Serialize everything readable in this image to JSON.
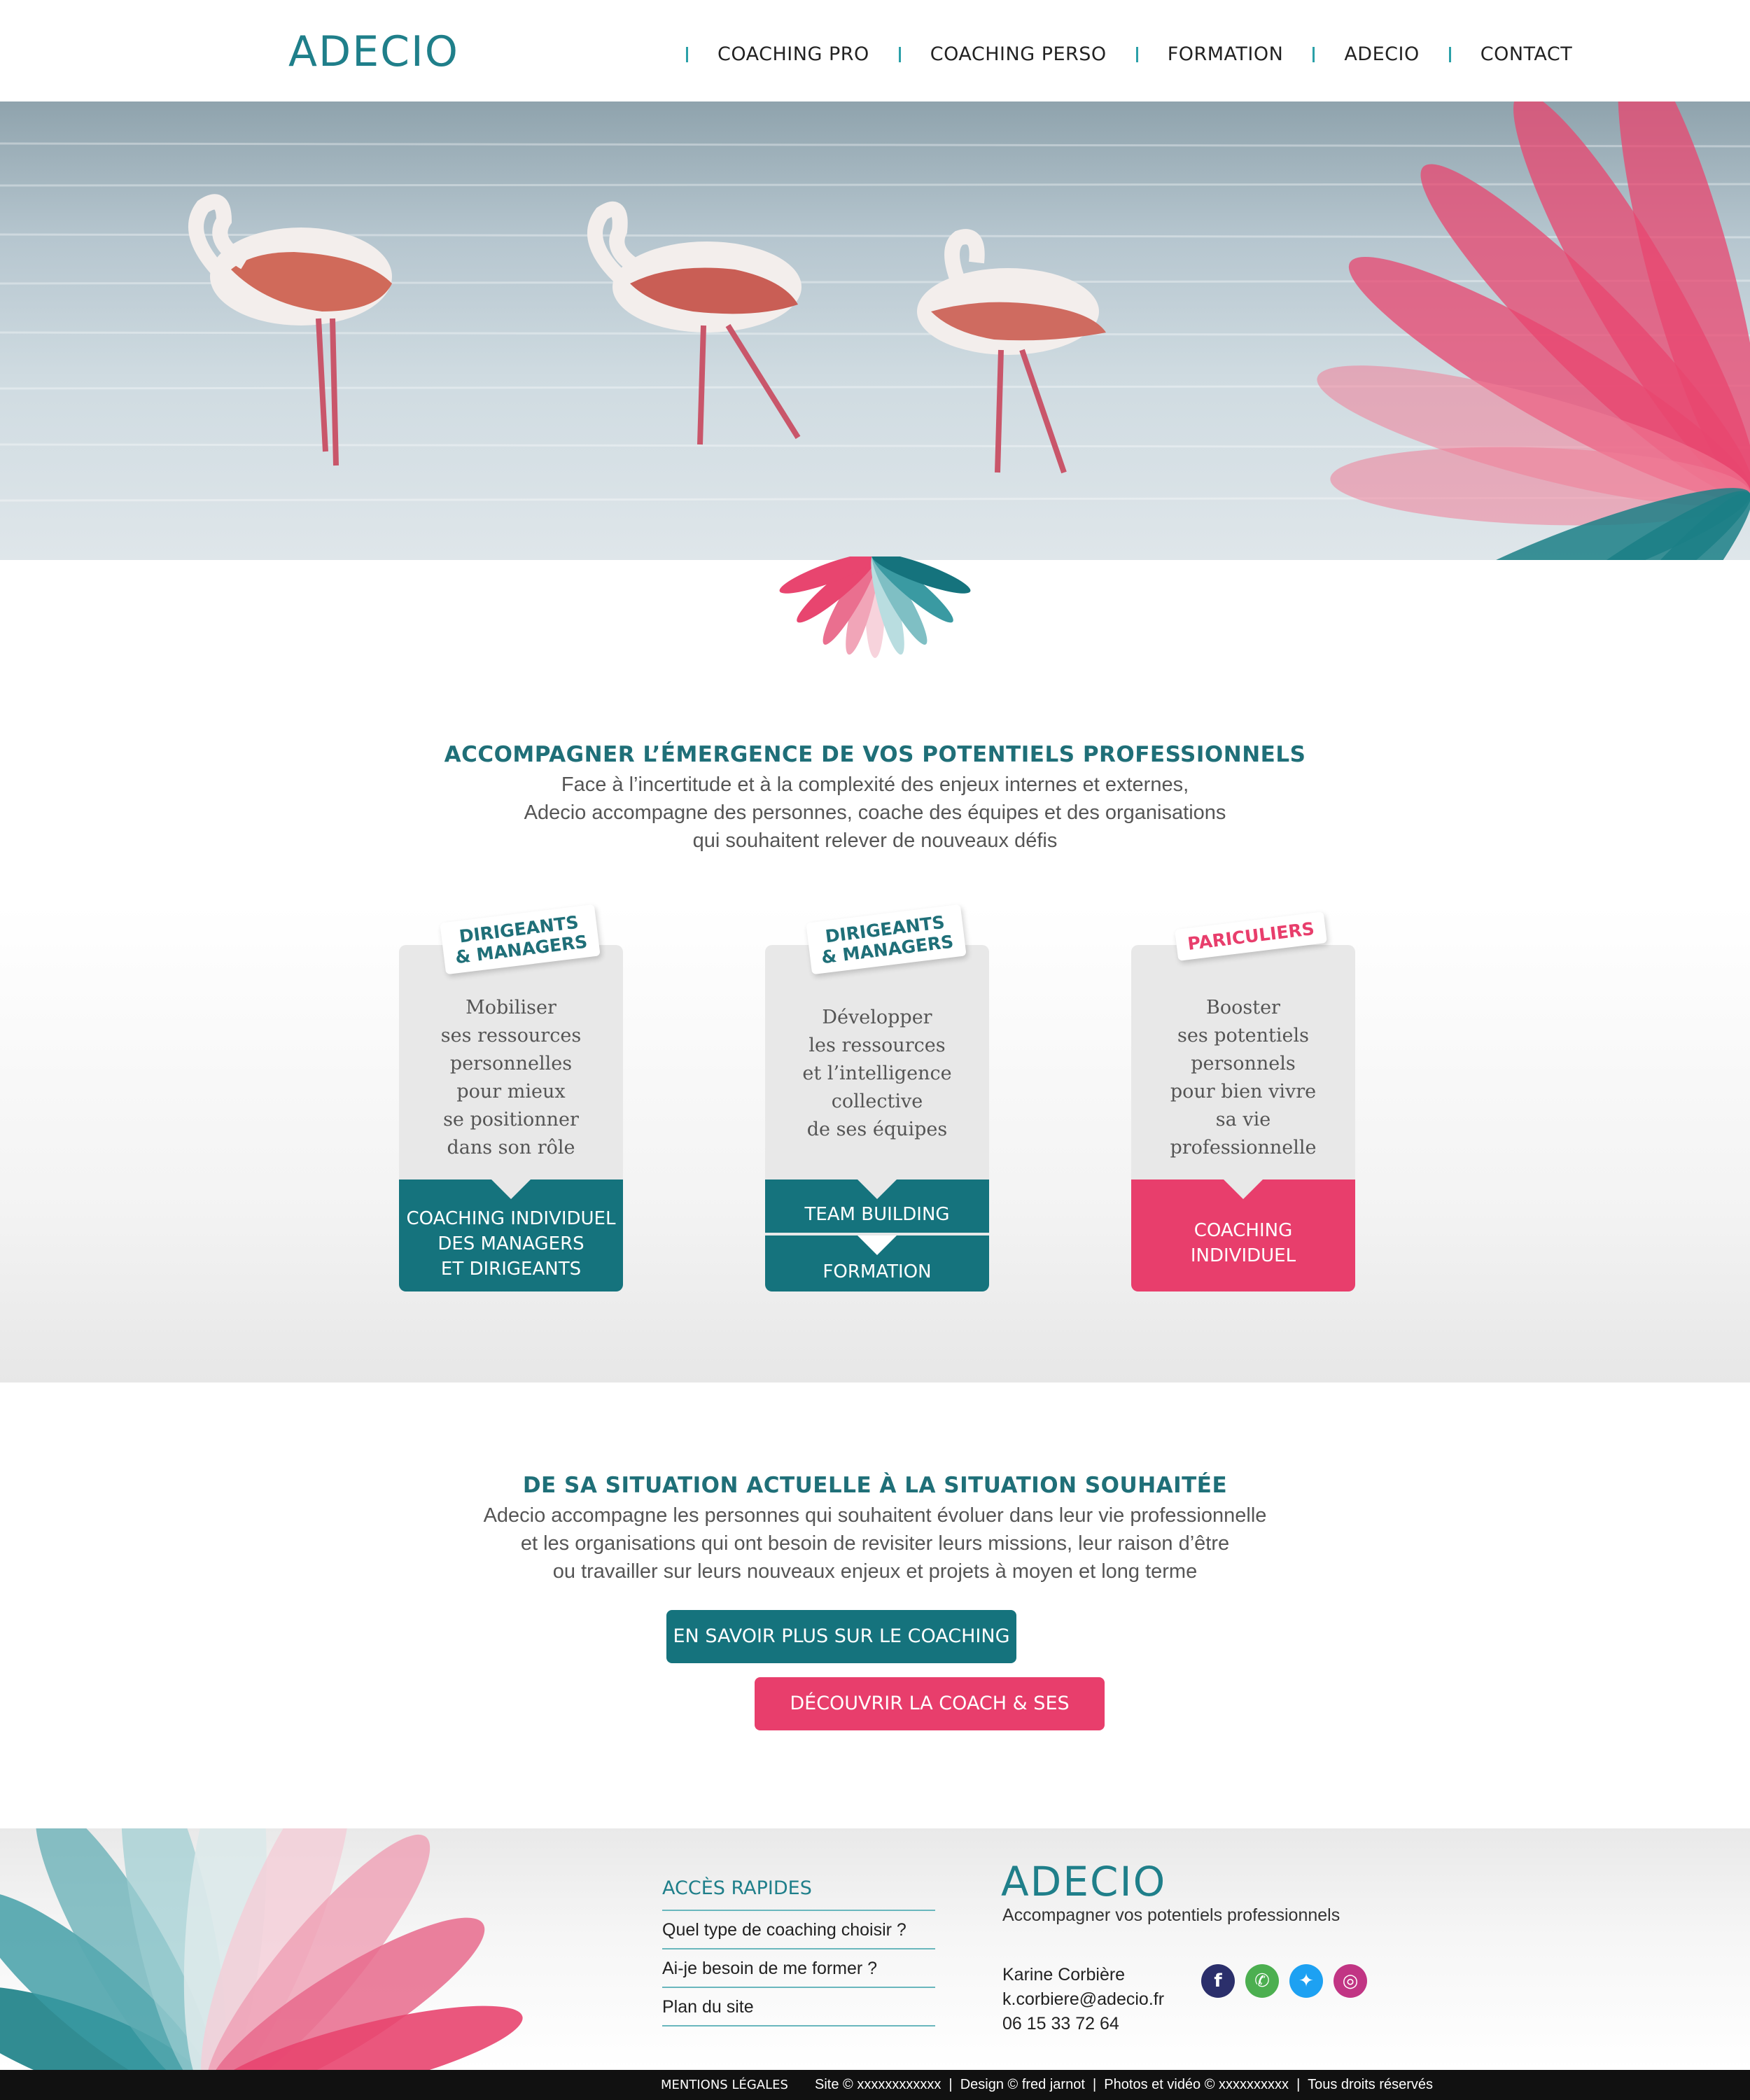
{
  "header": {
    "logo": "ADECIO",
    "nav": [
      "COACHING PRO",
      "COACHING PERSO",
      "FORMATION",
      "ADECIO",
      "CONTACT"
    ]
  },
  "intro": {
    "title": "ACCOMPAGNER L’ÉMERGENCE DE VOS POTENTIELS PROFESSIONNELS",
    "lines": [
      "Face à l’incertitude et à la complexité des enjeux internes et externes,",
      "Adecio accompagne des personnes, coache des équipes et des organisations",
      "qui souhaitent relever de nouveaux défis"
    ]
  },
  "cards": [
    {
      "tag_lines": [
        "DIRIGEANTS",
        "& MANAGERS"
      ],
      "body_lines": [
        "Mobiliser",
        "ses ressources",
        "personnelles",
        "pour mieux",
        "se positionner",
        "dans son rôle"
      ],
      "footer_lines": [
        "COACHING INDIVIDUEL",
        "DES MANAGERS",
        "ET DIRIGEANTS"
      ]
    },
    {
      "tag_lines": [
        "DIRIGEANTS",
        "& MANAGERS"
      ],
      "body_lines": [
        "Développer",
        "les ressources",
        "et l’intelligence",
        "collective",
        "de ses équipes"
      ],
      "footer_buttons": [
        "TEAM BUILDING",
        "FORMATION"
      ]
    },
    {
      "tag_lines": [
        "PARICULIERS"
      ],
      "body_lines": [
        "Booster",
        "ses potentiels",
        "personnels",
        "pour bien vivre",
        "sa vie",
        "professionnelle"
      ],
      "footer_lines": [
        "COACHING",
        "INDIVIDUEL"
      ]
    }
  ],
  "situation": {
    "title": "DE SA SITUATION ACTUELLE À LA SITUATION SOUHAITÉE",
    "lines": [
      "Adecio accompagne les personnes qui souhaitent évoluer dans leur vie professionnelle",
      "et les organisations qui ont besoin de revisiter leurs missions, leur raison d’être",
      "ou travailler sur leurs nouveaux enjeux et projets à moyen et long terme"
    ],
    "btn_coaching": "EN SAVOIR PLUS SUR LE COACHING",
    "btn_coach": "DÉCOUVRIR LA COACH & SES VALEURS"
  },
  "footer": {
    "quick_title": "ACCÈS RAPIDES",
    "quick_links": [
      "Quel type de coaching choisir ?",
      "Ai-je besoin de me former ?",
      "Plan du site"
    ],
    "logo": "ADECIO",
    "tagline": "Accompagner vos potentiels professionnels",
    "contact": [
      "Karine Corbière",
      "k.corbiere@adecio.fr",
      "06 15 33 72 64"
    ],
    "social": [
      {
        "icon": "facebook-icon",
        "glyph": "f",
        "color": "#2b2f6b"
      },
      {
        "icon": "whatsapp-icon",
        "glyph": "✆",
        "color": "#4caf50"
      },
      {
        "icon": "twitter-icon",
        "glyph": "✦",
        "color": "#1da1f2"
      },
      {
        "icon": "instagram-icon",
        "glyph": "◎",
        "color": "#c13584"
      }
    ]
  },
  "bottom_bar": {
    "legal": "MENTIONS LÉGALES",
    "credits": "Site © xxxxxxxxxxxx  |  Design © fred jarnot  |  Photos et vidéo © xxxxxxxxxx  |  Tous droits réservés"
  },
  "colors": {
    "teal": "#15737d",
    "pink": "#e83e6c",
    "title_teal": "#1f6f78"
  }
}
